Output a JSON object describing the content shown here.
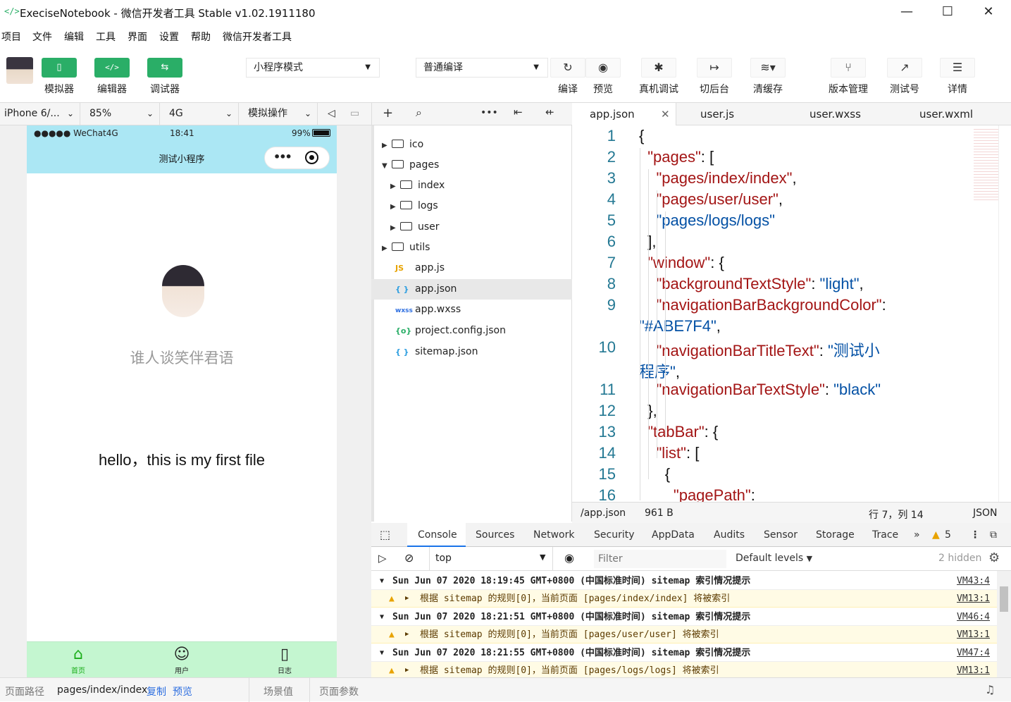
{
  "window": {
    "title": "ExeciseNotebook - 微信开发者工具 Stable v1.02.1911180",
    "minimize": "—",
    "maximize": "☐",
    "close": "✕"
  },
  "menu": [
    "项目",
    "文件",
    "编辑",
    "工具",
    "界面",
    "设置",
    "帮助",
    "微信开发者工具"
  ],
  "toolbar": {
    "simulator": "模拟器",
    "editor": "编辑器",
    "debugger": "调试器",
    "mode_select": "小程序模式",
    "compile_select": "普通编译",
    "compile": "编译",
    "preview": "预览",
    "remote_debug": "真机调试",
    "background": "切后台",
    "clear_cache": "清缓存",
    "version": "版本管理",
    "test_account": "测试号",
    "details": "详情"
  },
  "device_bar": {
    "device": "iPhone 6/...",
    "zoom": "85%",
    "network": "4G",
    "operation": "模拟操作"
  },
  "phone": {
    "signal": "●●●●● WeChat4G",
    "time": "18:41",
    "battery": "99%",
    "nav_title": "测试小程序",
    "nickname": "谁人谈笑伴君语",
    "hello": "hello，this is my first file",
    "tabs": [
      "首页",
      "用户",
      "日志"
    ],
    "nav_bg": "#ABE7F4",
    "tab_bg": "#C4F6D0"
  },
  "explorer": {
    "items": [
      {
        "name": "ico",
        "type": "folder",
        "expanded": false
      },
      {
        "name": "pages",
        "type": "folder",
        "expanded": true
      },
      {
        "name": "index",
        "type": "folder",
        "expanded": false
      },
      {
        "name": "logs",
        "type": "folder",
        "expanded": false
      },
      {
        "name": "user",
        "type": "folder",
        "expanded": false
      },
      {
        "name": "utils",
        "type": "folder",
        "expanded": false
      },
      {
        "name": "app.js",
        "type": "js",
        "badge": "JS"
      },
      {
        "name": "app.json",
        "type": "json",
        "badge": "{ }",
        "selected": true
      },
      {
        "name": "app.wxss",
        "type": "wxss",
        "badge": "wxss"
      },
      {
        "name": "project.config.json",
        "type": "config",
        "badge": "{o}"
      },
      {
        "name": "sitemap.json",
        "type": "json",
        "badge": "{ }"
      }
    ]
  },
  "editor": {
    "tabs": [
      "app.json",
      "user.js",
      "user.wxss",
      "user.wxml"
    ],
    "active_tab": "app.json",
    "line_numbers": [
      "1",
      "2",
      "3",
      "4",
      "5",
      "6",
      "7",
      "8",
      "9",
      "",
      "10",
      "",
      "11",
      "12",
      "13",
      "14",
      "15",
      "16"
    ],
    "lines": [
      [
        "{"
      ],
      [
        "  ",
        "\"pages\"",
        ": ["
      ],
      [
        "    ",
        "\"pages/index/index\"",
        ","
      ],
      [
        "    ",
        "\"pages/user/user\"",
        ","
      ],
      [
        "    ",
        "\"pages/logs/logs\"",
        ""
      ],
      [
        "  ",
        "],",
        ""
      ],
      [
        "  ",
        "\"window\"",
        ": {"
      ],
      [
        "    ",
        "\"backgroundTextStyle\"",
        ": ",
        "\"light\"",
        ","
      ],
      [
        "    ",
        "\"navigationBarBackgroundColor\"",
        ":"
      ],
      [
        "",
        "\"#ABE7F4\"",
        ","
      ],
      [
        "    ",
        "\"navigationBarTitleText\"",
        ": ",
        "\"测试小"
      ],
      [
        "",
        "程序\"",
        ","
      ],
      [
        "    ",
        "\"navigationBarTextStyle\"",
        ": ",
        "\"black\""
      ],
      [
        "  ",
        "},"
      ],
      [
        "  ",
        "\"tabBar\"",
        ": {"
      ],
      [
        "    ",
        "\"list\"",
        ": ["
      ],
      [
        "      ",
        "{"
      ],
      [
        "        ",
        "\"pagePath\"",
        ":"
      ]
    ],
    "status": {
      "path": "/app.json",
      "size": "961 B",
      "cursor": "行 7，列 14",
      "language": "JSON"
    }
  },
  "devtools": {
    "tabs": [
      "Console",
      "Sources",
      "Network",
      "Security",
      "AppData",
      "Audits",
      "Sensor",
      "Storage",
      "Trace"
    ],
    "active": "Console",
    "warn_count": "5",
    "context": "top",
    "filter_placeholder": "Filter",
    "levels": "Default levels",
    "hidden": "2 hidden",
    "rows": [
      {
        "type": "group",
        "text": "Sun Jun 07 2020 18:19:45 GMT+0800 (中国标准时间) sitemap 索引情况提示",
        "link": "VM43:4"
      },
      {
        "type": "warn",
        "text": "根据 sitemap 的规则[0]，当前页面 [pages/index/index] 将被索引",
        "link": "VM13:1"
      },
      {
        "type": "group",
        "text": "Sun Jun 07 2020 18:21:51 GMT+0800 (中国标准时间) sitemap 索引情况提示",
        "link": "VM46:4"
      },
      {
        "type": "warn",
        "text": "根据 sitemap 的规则[0]，当前页面 [pages/user/user] 将被索引",
        "link": "VM13:1"
      },
      {
        "type": "group",
        "text": "Sun Jun 07 2020 18:21:55 GMT+0800 (中国标准时间) sitemap 索引情况提示",
        "link": "VM47:4"
      },
      {
        "type": "warn",
        "text": "根据 sitemap 的规则[0]，当前页面 [pages/logs/logs] 将被索引",
        "link": "VM13:1"
      }
    ]
  },
  "statusbar": {
    "path_label": "页面路径",
    "path": "pages/index/index",
    "copy": "复制",
    "preview": "预览",
    "scene": "场景值",
    "params": "页面参数"
  }
}
